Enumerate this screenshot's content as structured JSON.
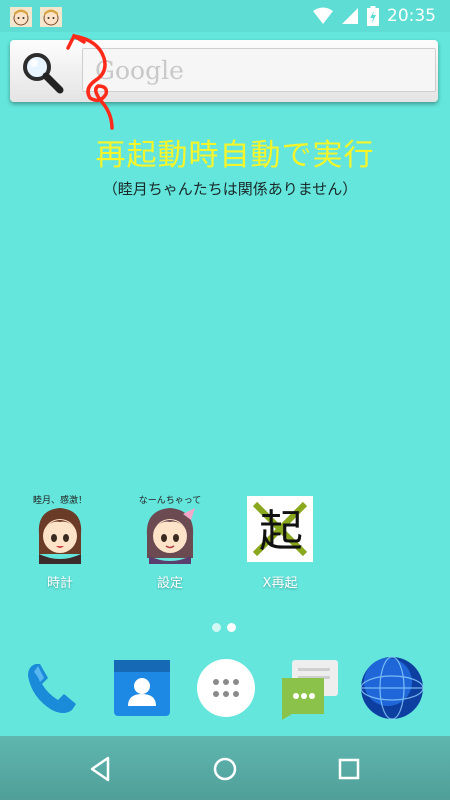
{
  "status_bar": {
    "time": "20:35",
    "notifications": [
      "notification-character-icon",
      "notification-character-icon"
    ],
    "icons": [
      "wifi-icon",
      "signal-icon",
      "battery-charging-icon"
    ]
  },
  "search": {
    "placeholder": "Google"
  },
  "headline": "再起動時自動で実行",
  "subline": "（睦月ちゃんたちは関係ありません）",
  "apps": [
    {
      "label": "時計",
      "badge": "睦月、感激！"
    },
    {
      "label": "設定",
      "badge": "なーんちゃって"
    },
    {
      "label": "X再起",
      "glyph": "起"
    }
  ],
  "colors": {
    "wallpaper": "#64e6dc",
    "headline": "#f5f52a",
    "annotation": "#ff2a1a"
  },
  "dock": [
    "phone-icon",
    "contacts-icon",
    "app-drawer-icon",
    "messaging-icon",
    "browser-globe-icon"
  ],
  "nav": [
    "back-icon",
    "home-icon",
    "recents-icon"
  ]
}
